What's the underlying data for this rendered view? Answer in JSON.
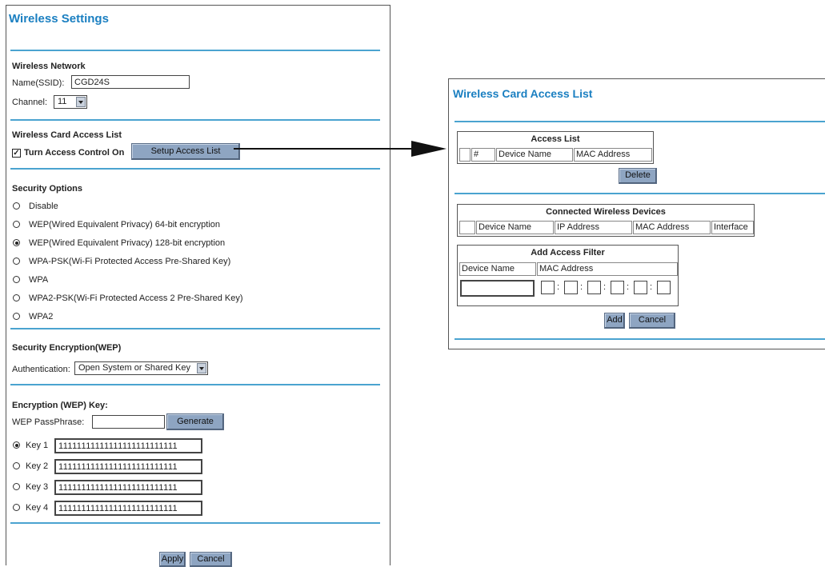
{
  "wireless_settings": {
    "title": "Wireless Settings",
    "network": {
      "heading": "Wireless Network",
      "ssid_label": "Name(SSID):",
      "ssid_value": "CGD24S",
      "channel_label": "Channel:",
      "channel_value": "11"
    },
    "access_list": {
      "heading": "Wireless Card Access List",
      "checkbox_label": "Turn Access Control On",
      "checked": true,
      "setup_button": "Setup Access List"
    },
    "security_options": {
      "heading": "Security Options",
      "options": [
        {
          "label": "Disable",
          "selected": false
        },
        {
          "label": "WEP(Wired Equivalent Privacy) 64-bit encryption",
          "selected": false
        },
        {
          "label": "WEP(Wired Equivalent Privacy) 128-bit encryption",
          "selected": true
        },
        {
          "label": "WPA-PSK(Wi-Fi Protected Access Pre-Shared Key)",
          "selected": false
        },
        {
          "label": "WPA",
          "selected": false
        },
        {
          "label": "WPA2-PSK(Wi-Fi Protected Access 2 Pre-Shared Key)",
          "selected": false
        },
        {
          "label": "WPA2",
          "selected": false
        }
      ]
    },
    "encryption": {
      "heading": "Security Encryption(WEP)",
      "auth_label": "Authentication:",
      "auth_value": "Open System or Shared Key"
    },
    "wep_key": {
      "heading": "Encryption (WEP) Key:",
      "passphrase_label": "WEP PassPhrase:",
      "passphrase_value": "",
      "generate_button": "Generate",
      "keys": [
        {
          "label": "Key 1",
          "value": "11111111111111111111111111",
          "selected": true
        },
        {
          "label": "Key 2",
          "value": "11111111111111111111111111",
          "selected": false
        },
        {
          "label": "Key 3",
          "value": "11111111111111111111111111",
          "selected": false
        },
        {
          "label": "Key 4",
          "value": "11111111111111111111111111",
          "selected": false
        }
      ]
    },
    "apply_button": "Apply",
    "cancel_button": "Cancel"
  },
  "access_list_page": {
    "title": "Wireless Card Access List",
    "access_list_table": {
      "header": "Access List",
      "columns": [
        "",
        "#",
        "Device Name",
        "MAC Address"
      ]
    },
    "delete_button": "Delete",
    "connected_table": {
      "header": "Connected Wireless Devices",
      "columns": [
        "",
        "Device Name",
        "IP Address",
        "MAC Address",
        "Interface"
      ]
    },
    "add_filter": {
      "header": "Add Access Filter",
      "device_name_label": "Device Name",
      "mac_label": "MAC Address",
      "device_name_value": "",
      "colon": ":"
    },
    "add_button": "Add",
    "cancel_button": "Cancel"
  },
  "colors": {
    "title": "#1a7fc1",
    "divider": "#4aa3d0",
    "button": "#8ea5c2"
  }
}
